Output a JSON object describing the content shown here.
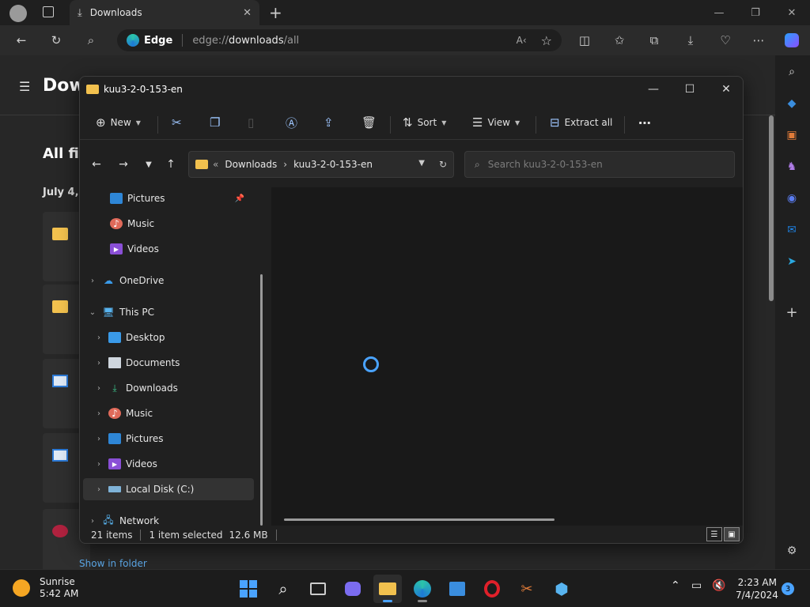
{
  "edge": {
    "tab_title": "Downloads",
    "address_brand": "Edge",
    "url_prefix": "edge://",
    "url_bold": "downloads",
    "url_suffix": "/all"
  },
  "page": {
    "title": "Dow",
    "section": "All fil",
    "date": "July 4, 2",
    "show_in_folder": "Show in folder"
  },
  "explorer": {
    "title": "kuu3-2-0-153-en",
    "commands": {
      "new": "New",
      "sort": "Sort",
      "view": "View",
      "extract_all": "Extract all"
    },
    "breadcrumb": {
      "prefix": "«",
      "items": [
        "Downloads",
        "kuu3-2-0-153-en"
      ]
    },
    "search_placeholder": "Search kuu3-2-0-153-en",
    "nav": [
      {
        "label": "Pictures"
      },
      {
        "label": "Music"
      },
      {
        "label": "Videos"
      },
      {
        "label": "OneDrive"
      },
      {
        "label": "This PC"
      },
      {
        "label": "Desktop"
      },
      {
        "label": "Documents"
      },
      {
        "label": "Downloads"
      },
      {
        "label": "Music"
      },
      {
        "label": "Pictures"
      },
      {
        "label": "Videos"
      },
      {
        "label": "Local Disk (C:)"
      },
      {
        "label": "Network"
      }
    ],
    "status": {
      "items": "21 items",
      "selected": "1 item selected",
      "size": "12.6 MB"
    }
  },
  "taskbar": {
    "weather_title": "Sunrise",
    "weather_time": "5:42 AM",
    "clock_time": "2:23 AM",
    "clock_date": "7/4/2024",
    "notification_count": "3"
  },
  "colors": {
    "accent": "#4aa3ff",
    "folder": "#f2c14e"
  }
}
